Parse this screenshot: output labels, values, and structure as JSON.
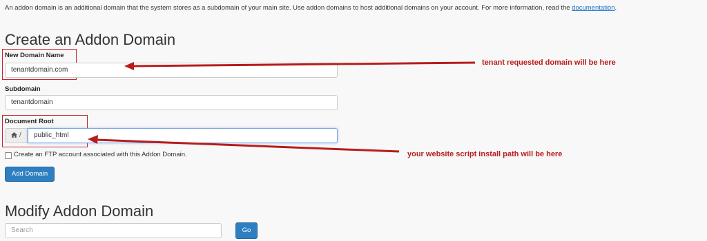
{
  "intro": {
    "text": "An addon domain is an additional domain that the system stores as a subdomain of your main site. Use addon domains to host additional domains on your account. For more information, read the",
    "link": "documentation",
    "end": "."
  },
  "create": {
    "title": "Create an Addon Domain",
    "new_domain_label": "New Domain Name",
    "new_domain_value": "tenantdomain.com",
    "subdomain_label": "Subdomain",
    "subdomain_value": "tenantdomain",
    "docroot_label": "Document Root",
    "docroot_prefix": "/",
    "docroot_value": "public_html",
    "ftp_checkbox_label": "Create an FTP account associated with this Addon Domain.",
    "submit_label": "Add Domain"
  },
  "modify": {
    "title": "Modify Addon Domain",
    "search_placeholder": "Search",
    "go_label": "Go"
  },
  "annotations": {
    "domain_note": "tenant requested domain will be here",
    "path_note": "your website script install path will be here"
  },
  "colors": {
    "annotation_red": "#b81c1c",
    "primary_button": "#2d7fc1",
    "link": "#1a6fc7"
  }
}
